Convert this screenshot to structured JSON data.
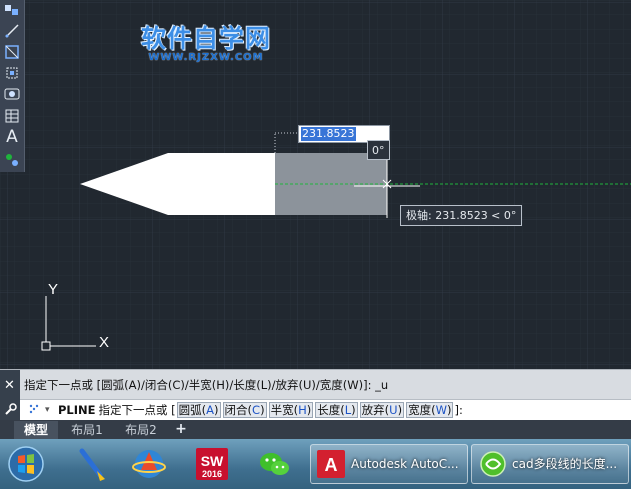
{
  "window": {
    "watermark_title": "软件自学网",
    "watermark_url": "WWW.RJZXW.COM"
  },
  "toolbar": {
    "text_tool_glyph": "A"
  },
  "drawing": {
    "dynamic_input_value": "231.8523",
    "angle_value": "0°",
    "polar_tooltip": "极轴: 231.8523 < 0°",
    "ucs_y": "Y",
    "ucs_x": "X"
  },
  "command": {
    "history": "指定下一点或 [圆弧(A)/闭合(C)/半宽(H)/长度(L)/放弃(U)/宽度(W)]: _u",
    "close_glyph": "✕",
    "prompt_arrow": "▾",
    "keyword": "PLINE",
    "prompt": "指定下一点或 [",
    "options": [
      {
        "label": "圆弧(",
        "key": "A",
        "end": ")"
      },
      {
        "label": "闭合(",
        "key": "C",
        "end": ")"
      },
      {
        "label": "半宽(",
        "key": "H",
        "end": ")"
      },
      {
        "label": "长度(",
        "key": "L",
        "end": ")"
      },
      {
        "label": "放弃(",
        "key": "U",
        "end": ")"
      },
      {
        "label": "宽度(",
        "key": "W",
        "end": ")"
      }
    ],
    "suffix": "]:"
  },
  "layout_tabs": [
    "模型",
    "布局1",
    "布局2"
  ],
  "layout_add": "+",
  "taskbar": {
    "sw_badge": "SW",
    "sw_year": "2016",
    "acad_title": "Autodesk AutoC...",
    "acad_icon_letter": "A",
    "browser_title": "cad多段线的长度..."
  },
  "colors": {
    "canvas": "#212830",
    "polyline_fill": "#ffffff",
    "preview_fill": "#8c939b",
    "polar_track": "#1fb43c",
    "selection": "#3875d7"
  }
}
